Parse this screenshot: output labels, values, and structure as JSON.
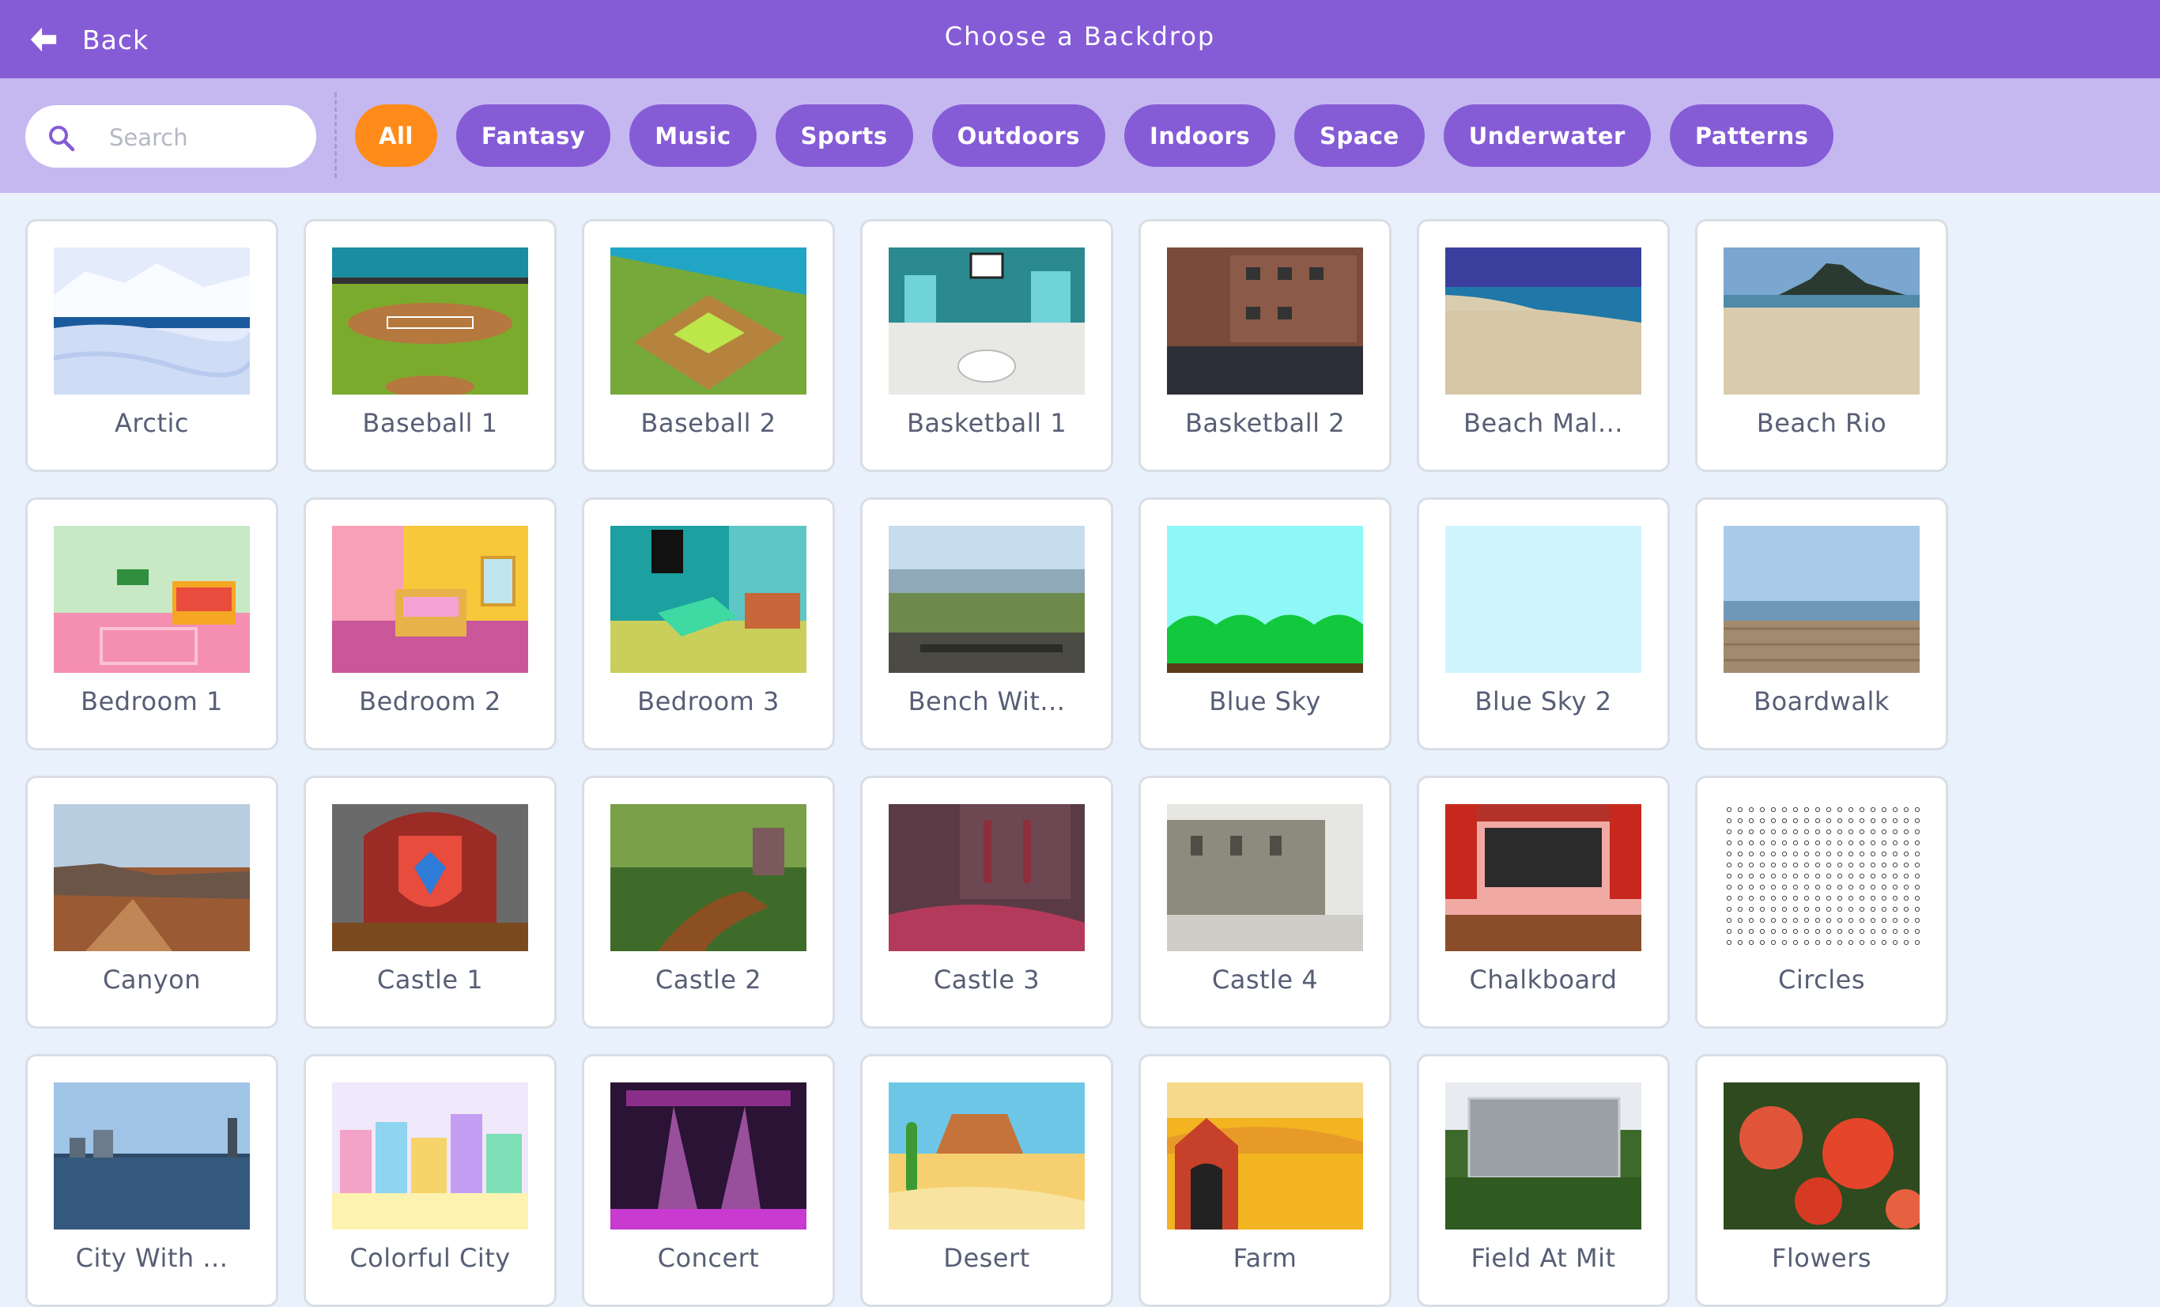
{
  "header": {
    "back_label": "Back",
    "title": "Choose a Backdrop",
    "icon": "arrow-left-icon",
    "color": "#855cd6"
  },
  "search": {
    "placeholder": "Search",
    "value": "",
    "icon": "search-icon"
  },
  "tags": [
    {
      "label": "All",
      "active": true
    },
    {
      "label": "Fantasy",
      "active": false
    },
    {
      "label": "Music",
      "active": false
    },
    {
      "label": "Sports",
      "active": false
    },
    {
      "label": "Outdoors",
      "active": false
    },
    {
      "label": "Indoors",
      "active": false
    },
    {
      "label": "Space",
      "active": false
    },
    {
      "label": "Underwater",
      "active": false
    },
    {
      "label": "Patterns",
      "active": false
    }
  ],
  "colors": {
    "active_tag": "#ff8c1a",
    "tag": "#855cd6",
    "filter_bar": "#c5b8f0",
    "background": "#e9f1fc"
  },
  "backdrops": [
    {
      "label": "Arctic"
    },
    {
      "label": "Baseball 1"
    },
    {
      "label": "Baseball 2"
    },
    {
      "label": "Basketball 1"
    },
    {
      "label": "Basketball 2"
    },
    {
      "label": "Beach Mal..."
    },
    {
      "label": "Beach Rio"
    },
    {
      "label": "Bedroom 1"
    },
    {
      "label": "Bedroom 2"
    },
    {
      "label": "Bedroom 3"
    },
    {
      "label": "Bench Wit..."
    },
    {
      "label": "Blue Sky"
    },
    {
      "label": "Blue Sky 2"
    },
    {
      "label": "Boardwalk"
    },
    {
      "label": "Canyon"
    },
    {
      "label": "Castle 1"
    },
    {
      "label": "Castle 2"
    },
    {
      "label": "Castle 3"
    },
    {
      "label": "Castle 4"
    },
    {
      "label": "Chalkboard"
    },
    {
      "label": "Circles"
    },
    {
      "label": "City With ..."
    },
    {
      "label": "Colorful City"
    },
    {
      "label": "Concert"
    },
    {
      "label": "Desert"
    },
    {
      "label": "Farm"
    },
    {
      "label": "Field At Mit"
    },
    {
      "label": "Flowers"
    }
  ]
}
